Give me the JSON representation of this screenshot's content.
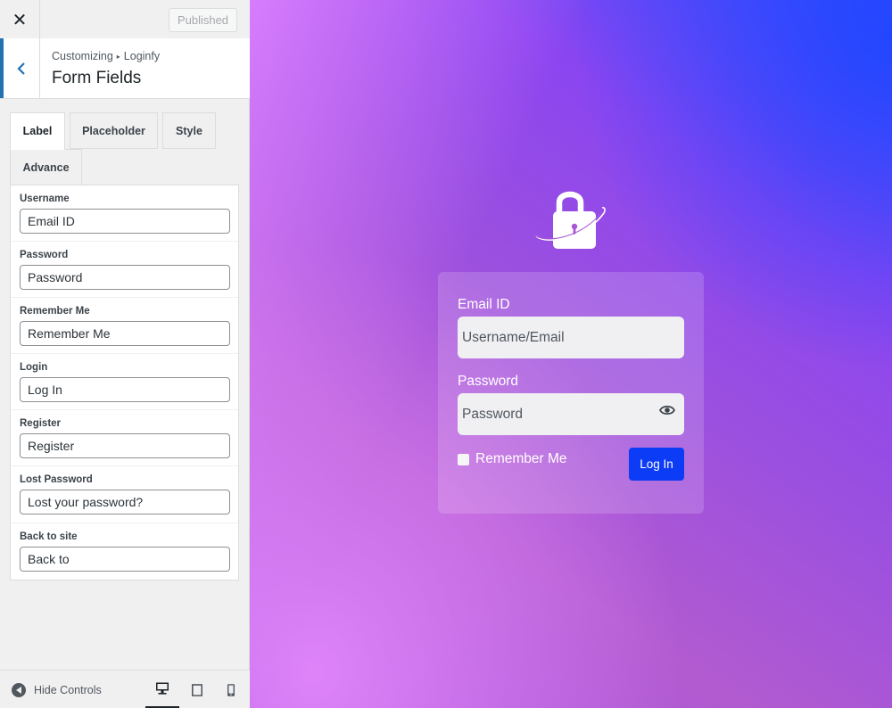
{
  "topbar": {
    "close_icon": "close-icon",
    "close_glyph": "✕",
    "published_label": "Published"
  },
  "section": {
    "breadcrumb_root": "Customizing",
    "breadcrumb_sep": "▸",
    "breadcrumb_child": "Loginfy",
    "title": "Form Fields"
  },
  "tabs": [
    {
      "label": "Label",
      "active": true
    },
    {
      "label": "Placeholder",
      "active": false
    },
    {
      "label": "Style",
      "active": false
    },
    {
      "label": "Advance",
      "active": false
    }
  ],
  "fields": [
    {
      "label": "Username",
      "value": "Email ID"
    },
    {
      "label": "Password",
      "value": "Password"
    },
    {
      "label": "Remember Me",
      "value": "Remember Me"
    },
    {
      "label": "Login",
      "value": "Log In"
    },
    {
      "label": "Register",
      "value": "Register"
    },
    {
      "label": "Lost Password",
      "value": "Lost your password?"
    },
    {
      "label": "Back to site",
      "value": "Back to"
    }
  ],
  "footer": {
    "hide_controls_label": "Hide Controls",
    "devices": [
      "desktop-icon",
      "tablet-icon",
      "mobile-icon"
    ],
    "active_device": "desktop"
  },
  "preview": {
    "login_form": {
      "username_label": "Email ID",
      "username_placeholder": "Username/Email",
      "password_label": "Password",
      "password_placeholder": "Password",
      "remember_label": "Remember Me",
      "login_button": "Log In"
    },
    "colors": {
      "accent": "#0c3cf5",
      "customizer_accent": "#2271b1",
      "gradient_pink": "#de81ff",
      "gradient_purple": "#8b45f0",
      "gradient_blue": "#3d4cff"
    }
  }
}
